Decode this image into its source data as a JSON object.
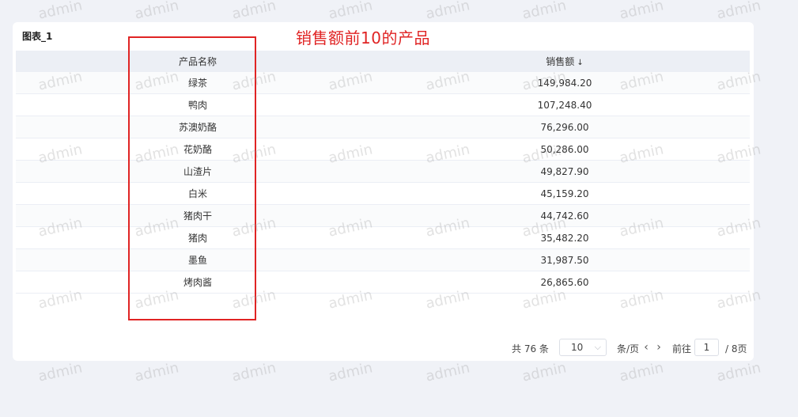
{
  "card": {
    "title": "图表_1"
  },
  "annotation": {
    "text": "销售额前10的产品"
  },
  "table": {
    "columns": [
      {
        "label": "产品名称"
      },
      {
        "label": "销售额",
        "sort_icon": "↓"
      }
    ],
    "rows": [
      {
        "name": "绿茶",
        "sales": "149,984.20"
      },
      {
        "name": "鸭肉",
        "sales": "107,248.40"
      },
      {
        "name": "苏澳奶酪",
        "sales": "76,296.00"
      },
      {
        "name": "花奶酪",
        "sales": "50,286.00"
      },
      {
        "name": "山渣片",
        "sales": "49,827.90"
      },
      {
        "name": "白米",
        "sales": "45,159.20"
      },
      {
        "name": "猪肉干",
        "sales": "44,742.60"
      },
      {
        "name": "猪肉",
        "sales": "35,482.20"
      },
      {
        "name": "墨鱼",
        "sales": "31,987.50"
      },
      {
        "name": "烤肉酱",
        "sales": "26,865.60"
      }
    ]
  },
  "pager": {
    "total": "共 76 条",
    "page_size": "10",
    "per_page_unit": "条/页",
    "prev_icon": "‹",
    "next_icon": "›",
    "goto_label": "前往",
    "current_page": "1",
    "total_pages": "/ 8页"
  },
  "watermark": {
    "text": "admin"
  },
  "colors": {
    "annotation": "#e02424",
    "header_bg": "#eceff5",
    "page_bg": "#f0f2f7"
  }
}
